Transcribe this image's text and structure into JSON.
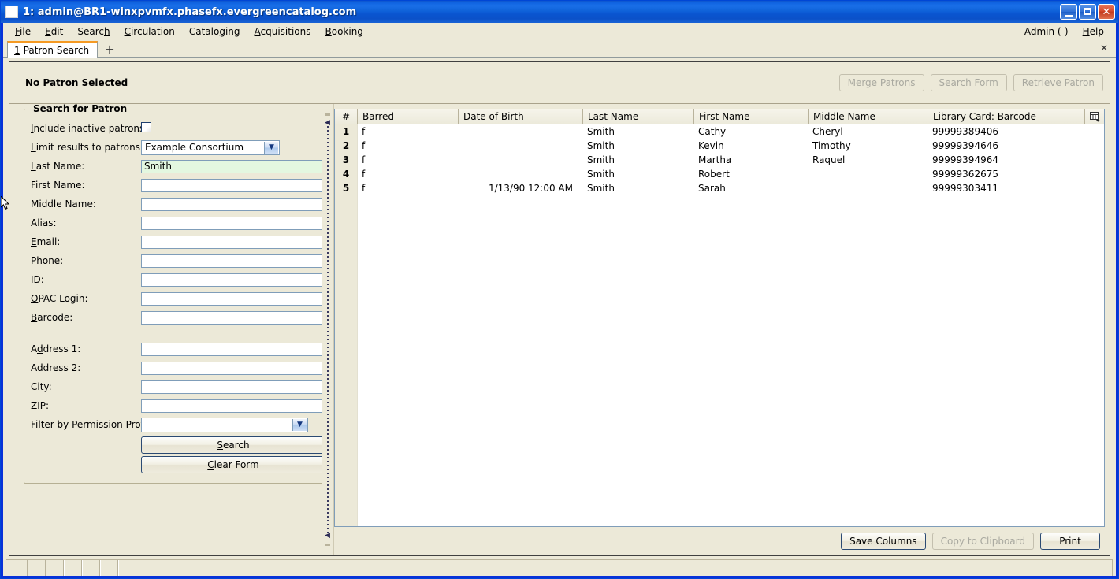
{
  "window": {
    "title": "1: admin@BR1-winxpvmfx.phasefx.evergreencatalog.com",
    "icon": "app-icon",
    "minimize_label": "_",
    "maximize_label": "",
    "close_label": "✕"
  },
  "menubar": {
    "items": [
      {
        "label": "File",
        "mnemonic": "F"
      },
      {
        "label": "Edit",
        "mnemonic": "E"
      },
      {
        "label": "Search",
        "mnemonic": "h"
      },
      {
        "label": "Circulation",
        "mnemonic": "C"
      },
      {
        "label": "Cataloging",
        "mnemonic": "g"
      },
      {
        "label": "Acquisitions",
        "mnemonic": "A"
      },
      {
        "label": "Booking",
        "mnemonic": "B"
      }
    ],
    "right_items": [
      {
        "label": "Admin (-)"
      },
      {
        "label": "Help",
        "mnemonic": "H"
      }
    ]
  },
  "tabs": {
    "items": [
      {
        "number": "1",
        "label": "Patron Search",
        "active": true
      }
    ],
    "new_tab_label": "+",
    "close_all_label": "✕"
  },
  "patron_bar": {
    "title": "No Patron Selected",
    "buttons": [
      {
        "label": "Merge Patrons",
        "enabled": false
      },
      {
        "label": "Search Form",
        "enabled": false
      },
      {
        "label": "Retrieve Patron",
        "enabled": false
      }
    ]
  },
  "search_form": {
    "legend": "Search for Patron",
    "include_inactive": {
      "label": "Include inactive patrons?",
      "checked": false
    },
    "limit_results": {
      "label": "Limit results to patrons in",
      "value": "Example Consortium"
    },
    "fields": [
      {
        "label": "Last Name:",
        "value": "Smith",
        "focused": true
      },
      {
        "label": "First Name:",
        "value": "",
        "focused": false
      },
      {
        "label": "Middle Name:",
        "value": "",
        "focused": false
      },
      {
        "label": "Alias:",
        "value": "",
        "focused": false
      },
      {
        "label": "Email:",
        "value": "",
        "focused": false
      },
      {
        "label": "Phone:",
        "value": "",
        "focused": false
      },
      {
        "label": "ID:",
        "value": "",
        "focused": false
      },
      {
        "label": "OPAC Login:",
        "value": "",
        "focused": false
      },
      {
        "label": "Barcode:",
        "value": "",
        "focused": false
      }
    ],
    "address_fields": [
      {
        "label": "Address 1:",
        "value": ""
      },
      {
        "label": "Address 2:",
        "value": ""
      },
      {
        "label": "City:",
        "value": ""
      },
      {
        "label": "ZIP:",
        "value": ""
      }
    ],
    "permission_profile": {
      "label": "Filter by Permission Profile:",
      "value": ""
    },
    "search_button": "Search",
    "clear_button": "Clear Form"
  },
  "results": {
    "columns": [
      {
        "key": "num",
        "label": "#",
        "width": 28
      },
      {
        "key": "barred",
        "label": "Barred",
        "width": 128
      },
      {
        "key": "dob",
        "label": "Date of Birth",
        "width": 158
      },
      {
        "key": "last",
        "label": "Last Name",
        "width": 141
      },
      {
        "key": "first",
        "label": "First Name",
        "width": 145
      },
      {
        "key": "middle",
        "label": "Middle Name",
        "width": 152
      },
      {
        "key": "barcode",
        "label": "Library Card: Barcode",
        "width": 190
      }
    ],
    "column_picker_icon": "column-picker-icon",
    "rows": [
      {
        "num": "1",
        "barred": "f",
        "dob": "",
        "last": "Smith",
        "first": "Cathy",
        "middle": "Cheryl",
        "barcode": "99999389406"
      },
      {
        "num": "2",
        "barred": "f",
        "dob": "",
        "last": "Smith",
        "first": "Kevin",
        "middle": "Timothy",
        "barcode": "99999394646"
      },
      {
        "num": "3",
        "barred": "f",
        "dob": "",
        "last": "Smith",
        "first": "Martha",
        "middle": "Raquel",
        "barcode": "99999394964"
      },
      {
        "num": "4",
        "barred": "f",
        "dob": "",
        "last": "Smith",
        "first": "Robert",
        "middle": "",
        "barcode": "99999362675"
      },
      {
        "num": "5",
        "barred": "f",
        "dob": "1/13/90 12:00 AM",
        "last": "Smith",
        "first": "Sarah",
        "middle": "",
        "barcode": "99999303411"
      }
    ],
    "footer_buttons": [
      {
        "label": "Save Columns",
        "enabled": true
      },
      {
        "label": "Copy to Clipboard",
        "enabled": false
      },
      {
        "label": "Print",
        "enabled": true
      }
    ]
  },
  "statusbar": {
    "cells": [
      "",
      "",
      "",
      "",
      "",
      "",
      ""
    ]
  },
  "colors": {
    "titlebar_blue": "#0f62e0",
    "window_face": "#ece9d8",
    "active_tab_accent": "#f59a23",
    "focused_field": "#e3f7e0",
    "field_border": "#7f9db9"
  }
}
